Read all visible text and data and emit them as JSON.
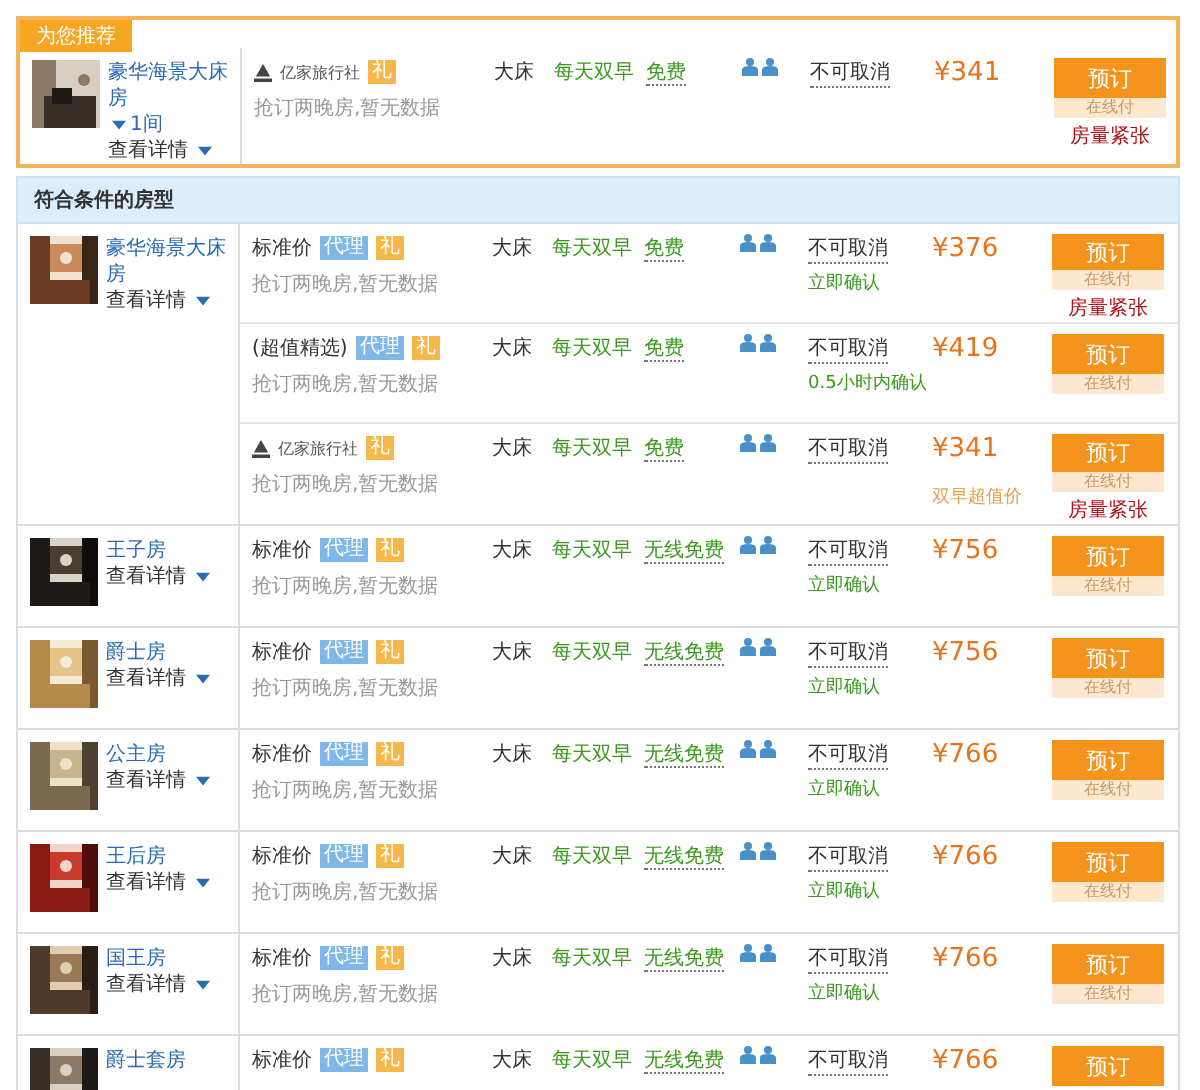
{
  "featured": {
    "badge": "为您推荐",
    "room": {
      "name": "豪华海景大床房",
      "quantity": "1间",
      "details": "查看详情"
    },
    "rates": [
      {
        "kind": "agency",
        "name": "亿家旅行社",
        "tags": [
          {
            "kind": "gift",
            "text": "礼"
          }
        ],
        "note": "抢订两晚房,暂无数据",
        "bed": "大床",
        "breakfast": "每天双早",
        "wifi": "免费",
        "cancel": "不可取消",
        "price": "¥341",
        "book": "预订",
        "pay": "在线付",
        "notice": "房量紧张"
      }
    ]
  },
  "section_title": "符合条件的房型",
  "rooms": [
    {
      "name": "豪华海景大床房",
      "details": "查看详情",
      "rates": [
        {
          "kind": "plain",
          "name": "标准价",
          "tags": [
            {
              "kind": "agent",
              "text": "代理"
            },
            {
              "kind": "gift",
              "text": "礼"
            }
          ],
          "note": "抢订两晚房,暂无数据",
          "bed": "大床",
          "breakfast": "每天双早",
          "wifi": "免费",
          "cancel": "不可取消",
          "confirm": "立即确认",
          "price": "¥376",
          "book": "预订",
          "pay": "在线付",
          "notice": "房量紧张"
        },
        {
          "kind": "plain",
          "name": "(超值精选)",
          "tags": [
            {
              "kind": "agent",
              "text": "代理"
            },
            {
              "kind": "gift",
              "text": "礼"
            }
          ],
          "note": "抢订两晚房,暂无数据",
          "bed": "大床",
          "breakfast": "每天双早",
          "wifi": "免费",
          "cancel": "不可取消",
          "confirm": "0.5小时内确认",
          "price": "¥419",
          "book": "预订",
          "pay": "在线付"
        },
        {
          "kind": "agency",
          "name": "亿家旅行社",
          "tags": [
            {
              "kind": "gift",
              "text": "礼"
            }
          ],
          "note": "抢订两晚房,暂无数据",
          "bed": "大床",
          "breakfast": "每天双早",
          "wifi": "免费",
          "cancel": "不可取消",
          "price": "¥341",
          "price_note": "双早超值价",
          "book": "预订",
          "pay": "在线付",
          "notice": "房量紧张"
        }
      ]
    },
    {
      "name": "王子房",
      "details": "查看详情",
      "rates": [
        {
          "kind": "plain",
          "name": "标准价",
          "tags": [
            {
              "kind": "agent",
              "text": "代理"
            },
            {
              "kind": "gift",
              "text": "礼"
            }
          ],
          "note": "抢订两晚房,暂无数据",
          "bed": "大床",
          "breakfast": "每天双早",
          "wifi": "无线免费",
          "cancel": "不可取消",
          "confirm": "立即确认",
          "price": "¥756",
          "book": "预订",
          "pay": "在线付"
        }
      ]
    },
    {
      "name": "爵士房",
      "details": "查看详情",
      "rates": [
        {
          "kind": "plain",
          "name": "标准价",
          "tags": [
            {
              "kind": "agent",
              "text": "代理"
            },
            {
              "kind": "gift",
              "text": "礼"
            }
          ],
          "note": "抢订两晚房,暂无数据",
          "bed": "大床",
          "breakfast": "每天双早",
          "wifi": "无线免费",
          "cancel": "不可取消",
          "confirm": "立即确认",
          "price": "¥756",
          "book": "预订",
          "pay": "在线付"
        }
      ]
    },
    {
      "name": "公主房",
      "details": "查看详情",
      "rates": [
        {
          "kind": "plain",
          "name": "标准价",
          "tags": [
            {
              "kind": "agent",
              "text": "代理"
            },
            {
              "kind": "gift",
              "text": "礼"
            }
          ],
          "note": "抢订两晚房,暂无数据",
          "bed": "大床",
          "breakfast": "每天双早",
          "wifi": "无线免费",
          "cancel": "不可取消",
          "confirm": "立即确认",
          "price": "¥766",
          "book": "预订",
          "pay": "在线付"
        }
      ]
    },
    {
      "name": "王后房",
      "details": "查看详情",
      "rates": [
        {
          "kind": "plain",
          "name": "标准价",
          "tags": [
            {
              "kind": "agent",
              "text": "代理"
            },
            {
              "kind": "gift",
              "text": "礼"
            }
          ],
          "note": "抢订两晚房,暂无数据",
          "bed": "大床",
          "breakfast": "每天双早",
          "wifi": "无线免费",
          "cancel": "不可取消",
          "confirm": "立即确认",
          "price": "¥766",
          "book": "预订",
          "pay": "在线付"
        }
      ]
    },
    {
      "name": "国王房",
      "details": "查看详情",
      "rates": [
        {
          "kind": "plain",
          "name": "标准价",
          "tags": [
            {
              "kind": "agent",
              "text": "代理"
            },
            {
              "kind": "gift",
              "text": "礼"
            }
          ],
          "note": "抢订两晚房,暂无数据",
          "bed": "大床",
          "breakfast": "每天双早",
          "wifi": "无线免费",
          "cancel": "不可取消",
          "confirm": "立即确认",
          "price": "¥766",
          "book": "预订",
          "pay": "在线付"
        }
      ]
    },
    {
      "name": "爵士套房",
      "rates": [
        {
          "kind": "plain",
          "name": "标准价",
          "tags": [
            {
              "kind": "agent",
              "text": "代理"
            },
            {
              "kind": "gift",
              "text": "礼"
            }
          ],
          "bed": "大床",
          "breakfast": "每天双早",
          "wifi": "无线免费",
          "cancel": "不可取消",
          "price": "¥766",
          "book": "预订"
        }
      ]
    }
  ]
}
